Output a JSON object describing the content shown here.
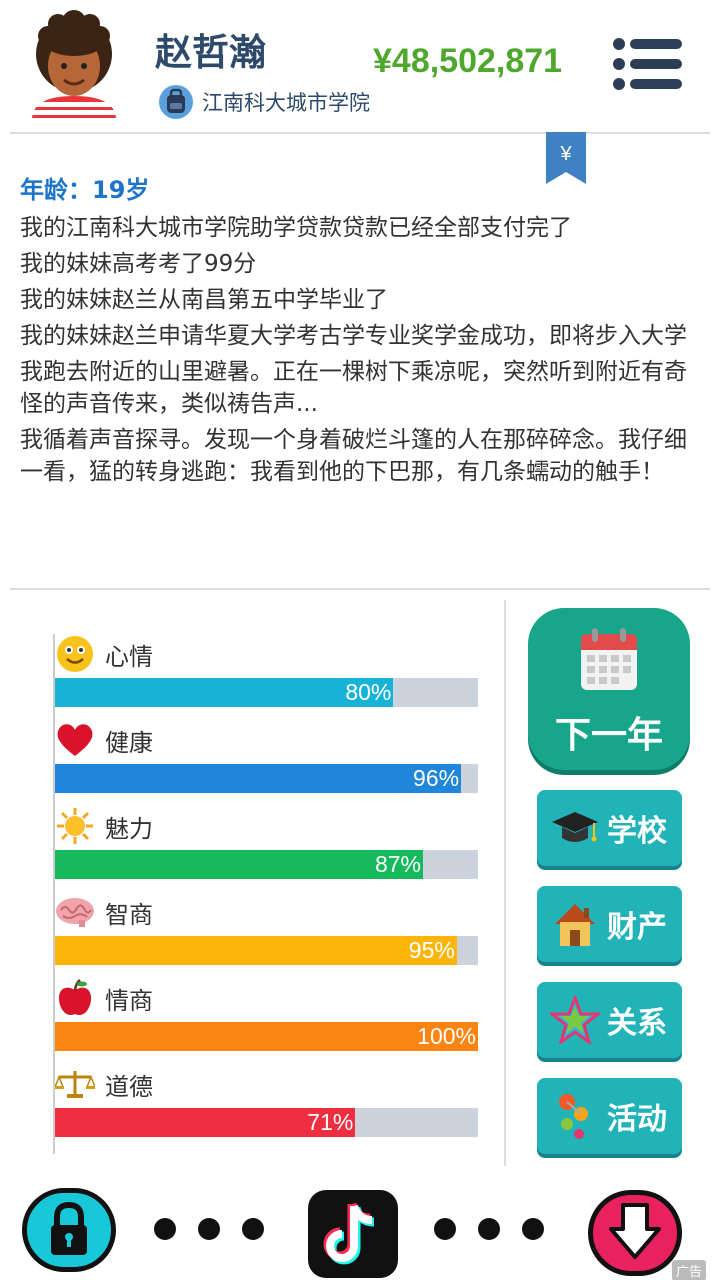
{
  "header": {
    "name": "赵哲瀚",
    "school": "江南科大城市学院",
    "money": "¥48,502,871",
    "bookmark_symbol": "¥"
  },
  "story": {
    "age": "年龄：19岁",
    "lines": [
      "我的江南科大城市学院助学贷款贷款已经全部支付完了",
      "我的妹妹高考考了99分",
      "我的妹妹赵兰从南昌第五中学毕业了",
      "我的妹妹赵兰申请华夏大学考古学专业奖学金成功，即将步入大学",
      "我跑去附近的山里避暑。正在一棵树下乘凉呢，突然听到附近有奇怪的声音传来，类似祷告声...",
      "我循着声音探寻。发现一个身着破烂斗篷的人在那碎碎念。我仔细一看，猛的转身逃跑：我看到他的下巴那，有几条蠕动的触手！"
    ]
  },
  "stats": [
    {
      "key": "mood",
      "label": "心情",
      "value": 80,
      "value_text": "80%",
      "color": "#16b3d6",
      "icon": "smiley-face-icon"
    },
    {
      "key": "health",
      "label": "健康",
      "value": 96,
      "value_text": "96%",
      "color": "#1f86d9",
      "icon": "heart-icon"
    },
    {
      "key": "charm",
      "label": "魅力",
      "value": 87,
      "value_text": "87%",
      "color": "#16b95c",
      "icon": "sun-icon"
    },
    {
      "key": "iq",
      "label": "智商",
      "value": 95,
      "value_text": "95%",
      "color": "#fbb50b",
      "icon": "brain-icon"
    },
    {
      "key": "eq",
      "label": "情商",
      "value": 100,
      "value_text": "100%",
      "color": "#fb8412",
      "icon": "apple-icon"
    },
    {
      "key": "morality",
      "label": "道德",
      "value": 71,
      "value_text": "71%",
      "color": "#ee2f42",
      "icon": "scales-icon"
    }
  ],
  "actions": {
    "next_year": "下一年",
    "school": "学校",
    "assets": "财产",
    "relations": "关系",
    "activities": "活动"
  },
  "footer": {
    "ad": "广告"
  },
  "colors": {
    "money": "#4fa72d",
    "teal_button": "#21b3b8",
    "next_button": "#17a689",
    "name": "#2e4a6b"
  }
}
